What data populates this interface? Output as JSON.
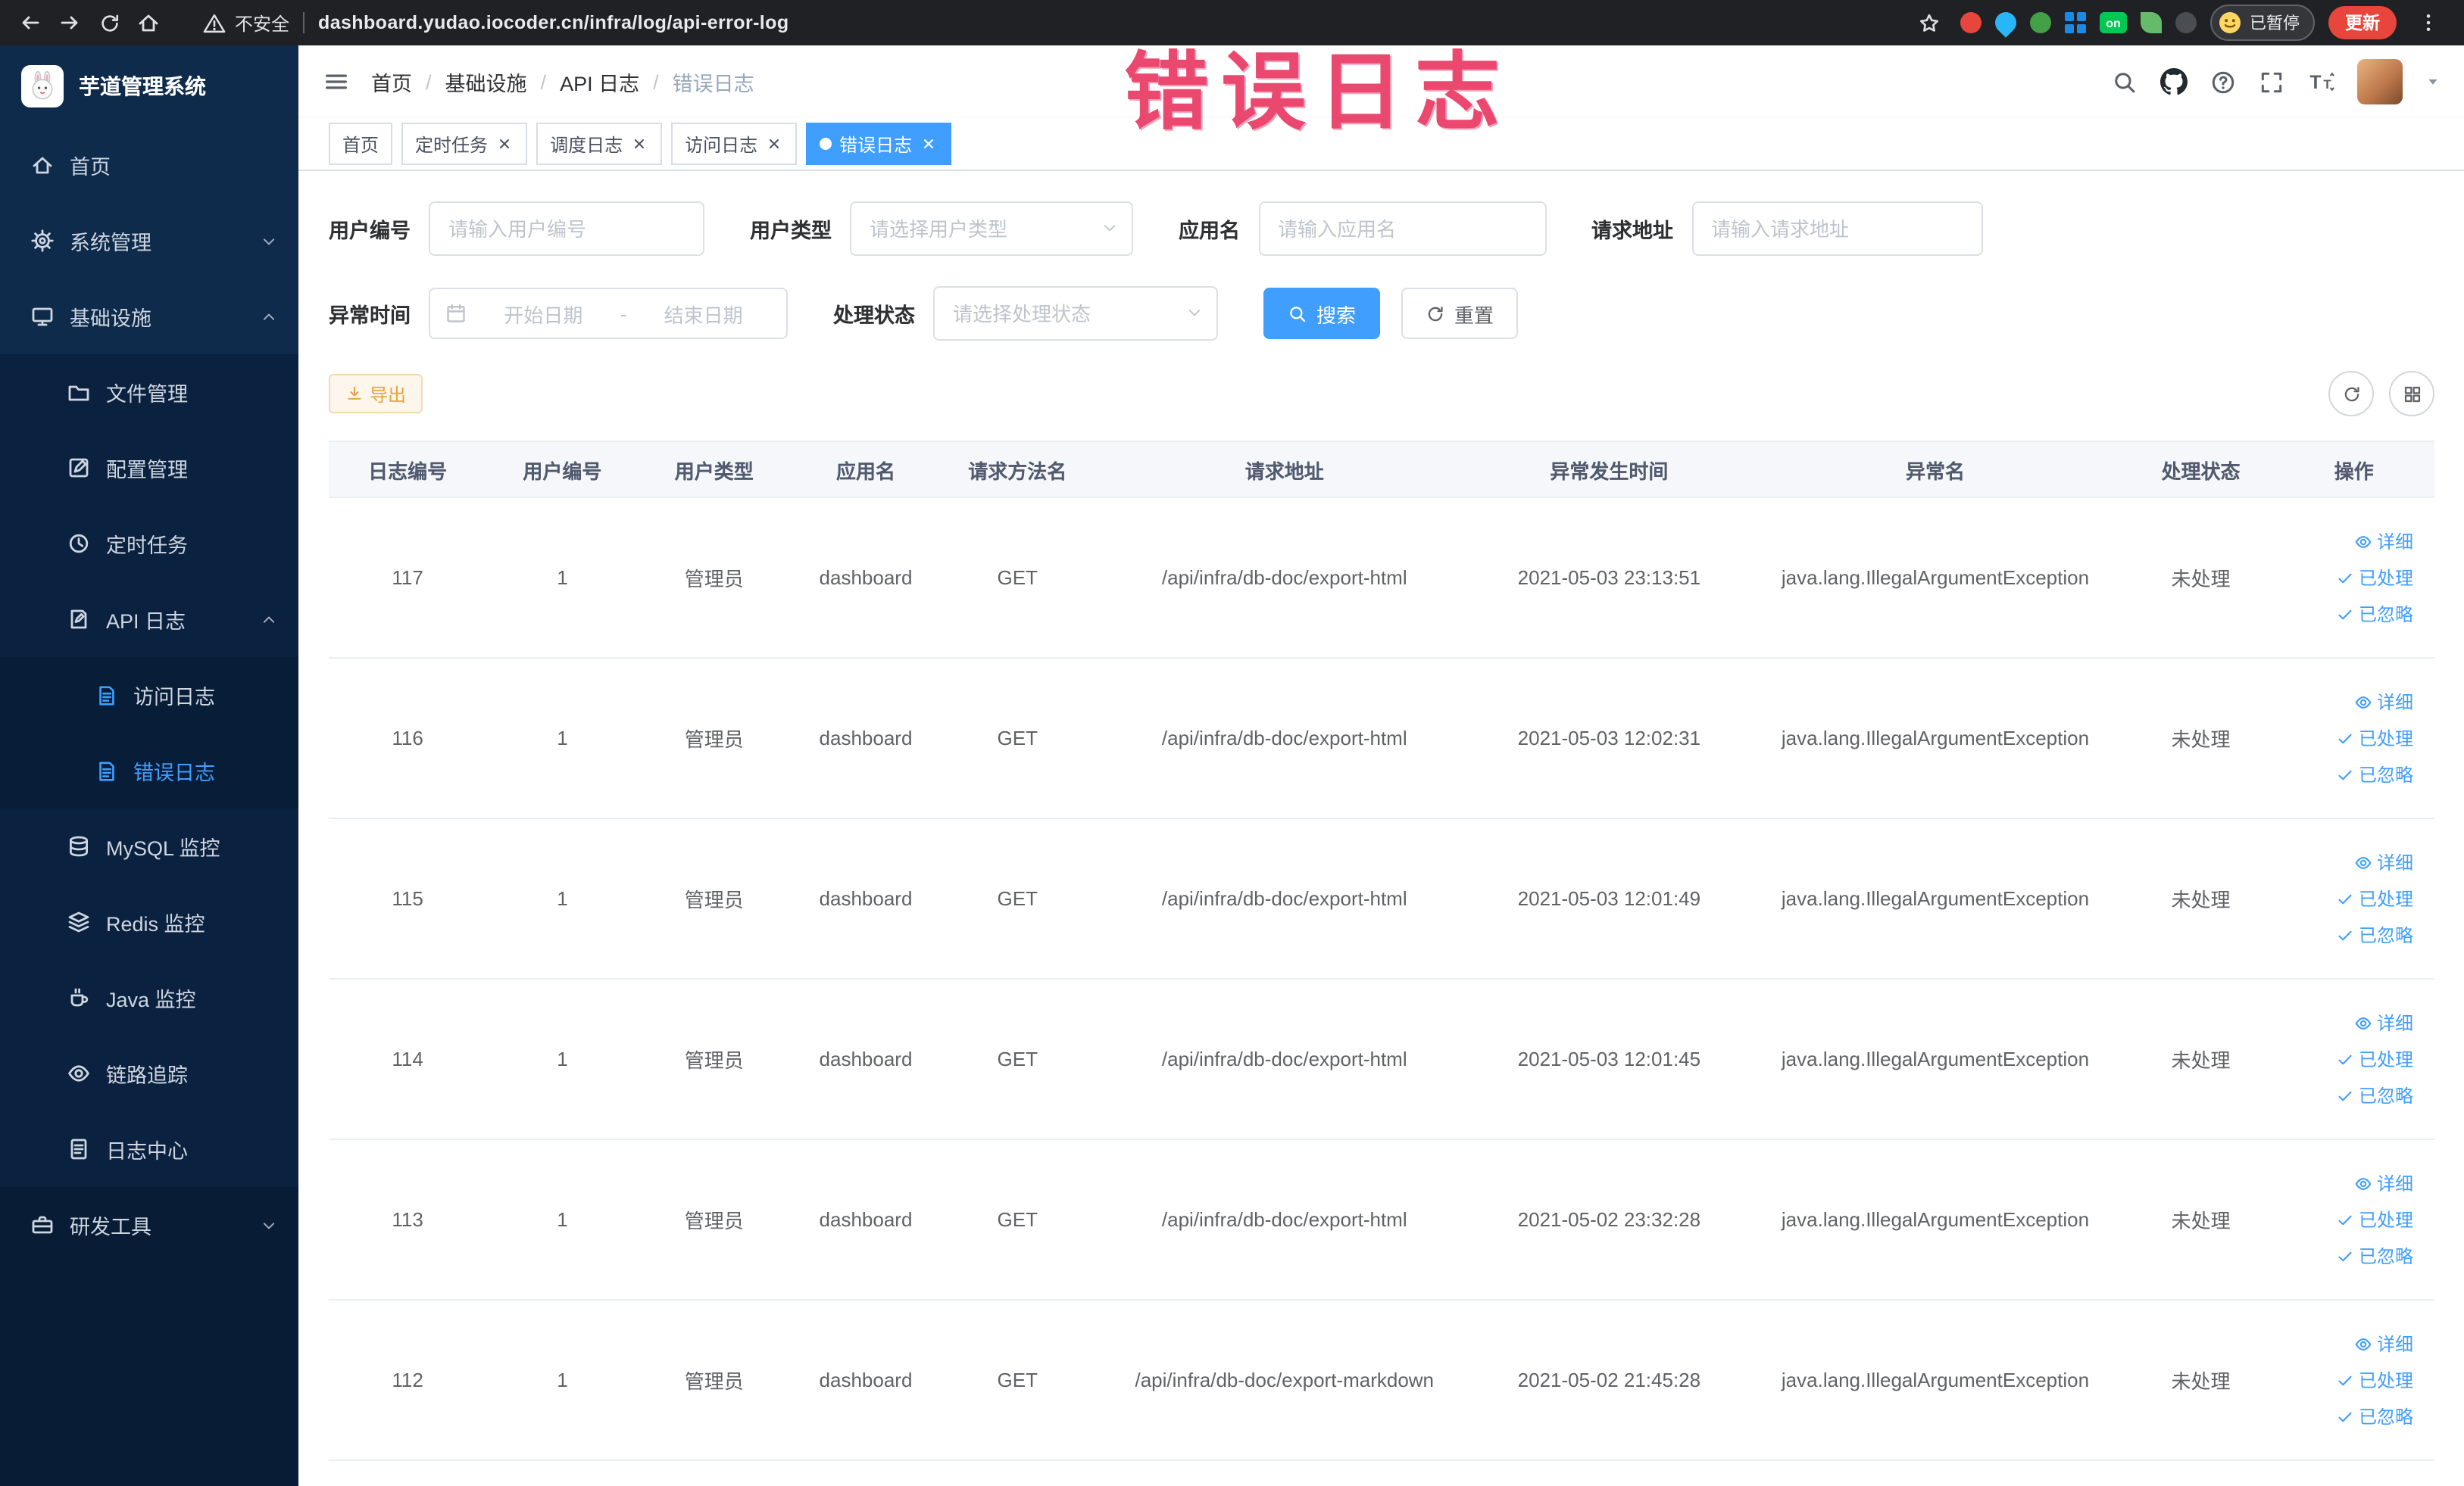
{
  "browser": {
    "security_label": "不安全",
    "url": "dashboard.yudao.iocoder.cn/infra/log/api-error-log",
    "ext_on_label": "on",
    "profile_label": "已暂停",
    "update_label": "更新"
  },
  "annotation": {
    "text": "错误日志",
    "color": "#ea486f"
  },
  "sidebar": {
    "title": "芋道管理系统",
    "items": [
      {
        "label": "首页"
      },
      {
        "label": "系统管理"
      },
      {
        "label": "基础设施"
      },
      {
        "label": "文件管理"
      },
      {
        "label": "配置管理"
      },
      {
        "label": "定时任务"
      },
      {
        "label": "API 日志"
      },
      {
        "label": "访问日志"
      },
      {
        "label": "错误日志"
      },
      {
        "label": "MySQL 监控"
      },
      {
        "label": "Redis 监控"
      },
      {
        "label": "Java 监控"
      },
      {
        "label": "链路追踪"
      },
      {
        "label": "日志中心"
      },
      {
        "label": "研发工具"
      }
    ]
  },
  "header": {
    "breadcrumb": [
      "首页",
      "基础设施",
      "API 日志",
      "错误日志"
    ],
    "separator": "/"
  },
  "tabs": [
    {
      "label": "首页"
    },
    {
      "label": "定时任务"
    },
    {
      "label": "调度日志"
    },
    {
      "label": "访问日志"
    },
    {
      "label": "错误日志"
    }
  ],
  "filters": {
    "user_id": {
      "label": "用户编号",
      "placeholder": "请输入用户编号"
    },
    "user_type": {
      "label": "用户类型",
      "placeholder": "请选择用户类型"
    },
    "app_name": {
      "label": "应用名",
      "placeholder": "请输入应用名"
    },
    "request_url": {
      "label": "请求地址",
      "placeholder": "请输入请求地址"
    },
    "exception_time": {
      "label": "异常时间",
      "start_placeholder": "开始日期",
      "separator": "-",
      "end_placeholder": "结束日期"
    },
    "process_status": {
      "label": "处理状态",
      "placeholder": "请选择处理状态"
    },
    "search_label": "搜索",
    "reset_label": "重置"
  },
  "toolbar": {
    "export_label": "导出"
  },
  "table": {
    "columns": [
      "日志编号",
      "用户编号",
      "用户类型",
      "应用名",
      "请求方法名",
      "请求地址",
      "异常发生时间",
      "异常名",
      "处理状态",
      "操作"
    ],
    "action_labels": [
      "详细",
      "已处理",
      "已忽略"
    ],
    "rows": [
      {
        "id": "117",
        "user_id": "1",
        "user_type": "管理员",
        "app_name": "dashboard",
        "method": "GET",
        "url": "/api/infra/db-doc/export-html",
        "time": "2021-05-03 23:13:51",
        "exception": "java.lang.IllegalArgumentException",
        "status": "未处理"
      },
      {
        "id": "116",
        "user_id": "1",
        "user_type": "管理员",
        "app_name": "dashboard",
        "method": "GET",
        "url": "/api/infra/db-doc/export-html",
        "time": "2021-05-03 12:02:31",
        "exception": "java.lang.IllegalArgumentException",
        "status": "未处理"
      },
      {
        "id": "115",
        "user_id": "1",
        "user_type": "管理员",
        "app_name": "dashboard",
        "method": "GET",
        "url": "/api/infra/db-doc/export-html",
        "time": "2021-05-03 12:01:49",
        "exception": "java.lang.IllegalArgumentException",
        "status": "未处理"
      },
      {
        "id": "114",
        "user_id": "1",
        "user_type": "管理员",
        "app_name": "dashboard",
        "method": "GET",
        "url": "/api/infra/db-doc/export-html",
        "time": "2021-05-03 12:01:45",
        "exception": "java.lang.IllegalArgumentException",
        "status": "未处理"
      },
      {
        "id": "113",
        "user_id": "1",
        "user_type": "管理员",
        "app_name": "dashboard",
        "method": "GET",
        "url": "/api/infra/db-doc/export-html",
        "time": "2021-05-02 23:32:28",
        "exception": "java.lang.IllegalArgumentException",
        "status": "未处理"
      },
      {
        "id": "112",
        "user_id": "1",
        "user_type": "管理员",
        "app_name": "dashboard",
        "method": "GET",
        "url": "/api/infra/db-doc/export-markdown",
        "time": "2021-05-02 21:45:28",
        "exception": "java.lang.IllegalArgumentException",
        "status": "未处理"
      }
    ]
  }
}
